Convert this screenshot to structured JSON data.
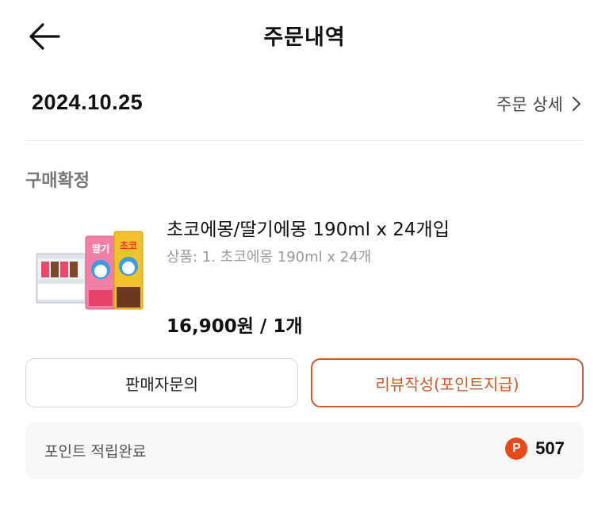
{
  "header": {
    "title": "주문내역",
    "back_icon": "arrow-left-icon"
  },
  "order": {
    "date": "2024.10.25",
    "detail_link": "주문 상세",
    "status": "구매확정"
  },
  "product": {
    "name": "초코에몽/딸기에몽 190ml x 24개입",
    "option": "상품: 1. 초코에몽 190ml x 24개",
    "price": "16,900원 / 1개",
    "thumb_text_strawberry": "딸기",
    "thumb_text_choco": "초코"
  },
  "actions": {
    "inquiry_label": "판매자문의",
    "review_label": "리뷰작성(포인트지급)"
  },
  "points": {
    "label": "포인트 적립완료",
    "icon_letter": "P",
    "value": "507"
  },
  "colors": {
    "accent": "#c85a2c",
    "point_icon": "#e64a19",
    "status_text": "#777777"
  }
}
